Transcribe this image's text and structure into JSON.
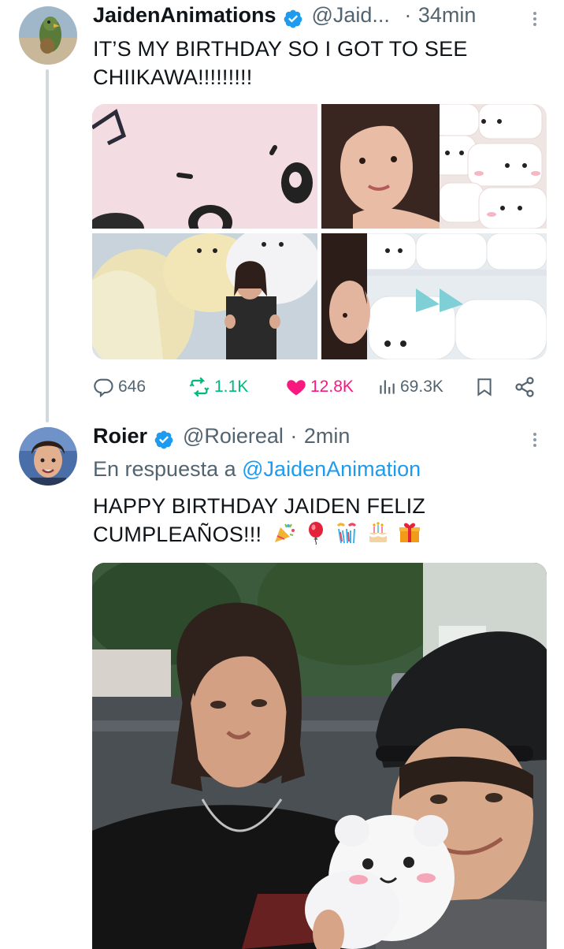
{
  "tweet1": {
    "author_name": "JaidenAnimations",
    "author_handle": "@Jaid...",
    "dot": "·",
    "time": "34min",
    "text_line1": "IT’S MY BIRTHDAY SO I GOT TO SEE",
    "text_line2": "CHIIKAWA!!!!!!!!!",
    "stats": {
      "replies": "646",
      "reposts": "1.1K",
      "likes": "12.8K",
      "views": "69.3K"
    }
  },
  "tweet2": {
    "author_name": "Roier",
    "author_handle": "@Roiereal",
    "dot": "·",
    "time": "2min",
    "reply_prefix": "En respuesta a",
    "reply_handle": "@JaidenAnimation",
    "text_line1": "HAPPY BIRTHDAY JAIDEN FELIZ",
    "text_line2": "CUMPLEAÑOS!!!",
    "emojis": [
      "party-popper",
      "balloon",
      "confetti-ball",
      "birthday-cake",
      "wrapped-gift"
    ]
  },
  "colors": {
    "verified": "#1d9bf0",
    "repost": "#00ba7c",
    "like": "#f91880",
    "secondary": "#536471",
    "link": "#1d9bf0"
  }
}
